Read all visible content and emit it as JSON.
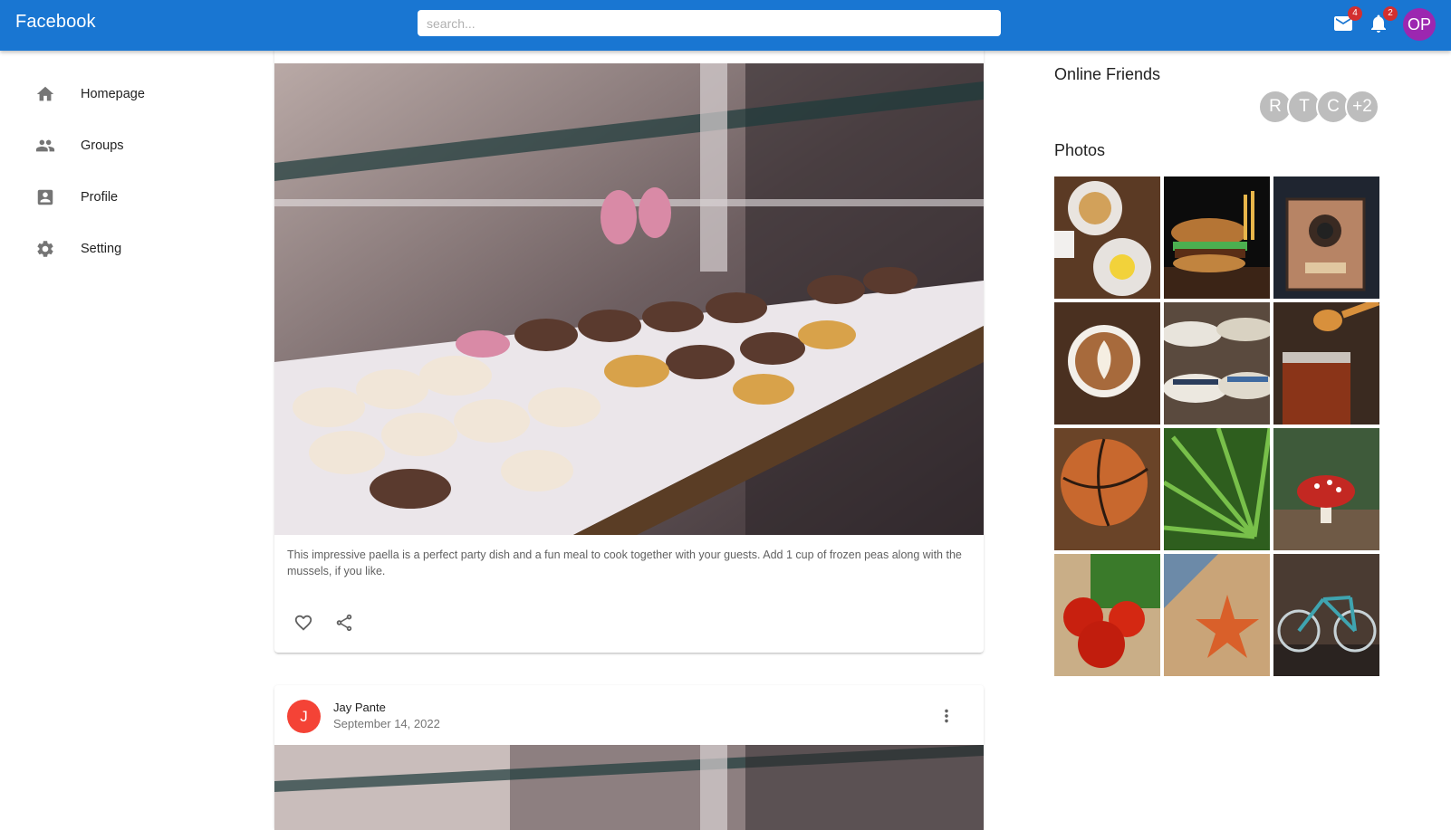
{
  "app": {
    "title": "Facebook",
    "search_placeholder": "search...",
    "mail_badge": "4",
    "notifications_badge": "2",
    "user_initials": "OP",
    "user_avatar_color": "#9c27b0",
    "accent_color": "#1976d2"
  },
  "sidebar": {
    "items": [
      {
        "label": "Homepage",
        "icon": "home-icon"
      },
      {
        "label": "Groups",
        "icon": "groups-icon"
      },
      {
        "label": "Profile",
        "icon": "profile-icon"
      },
      {
        "label": "Setting",
        "icon": "settings-icon"
      }
    ]
  },
  "feed": {
    "posts": [
      {
        "caption": "This impressive paella is a perfect party dish and a fun meal to cook together with your guests. Add 1 cup of frozen peas along with the mussels, if you like.",
        "actions": [
          "favorite-icon",
          "share-icon"
        ]
      },
      {
        "author": "Jay Pante",
        "date": "September 14, 2022",
        "avatar_initial": "J",
        "avatar_color": "#f44336"
      }
    ]
  },
  "right_panel": {
    "online_friends_title": "Online Friends",
    "friends": [
      "R",
      "T",
      "C",
      "+2"
    ],
    "photos_title": "Photos",
    "photos": [
      "breakfast",
      "burger",
      "camera",
      "coffee",
      "hats",
      "honey",
      "basketball",
      "fern",
      "mushroom",
      "tomatoes",
      "starfish",
      "bicycle"
    ]
  }
}
